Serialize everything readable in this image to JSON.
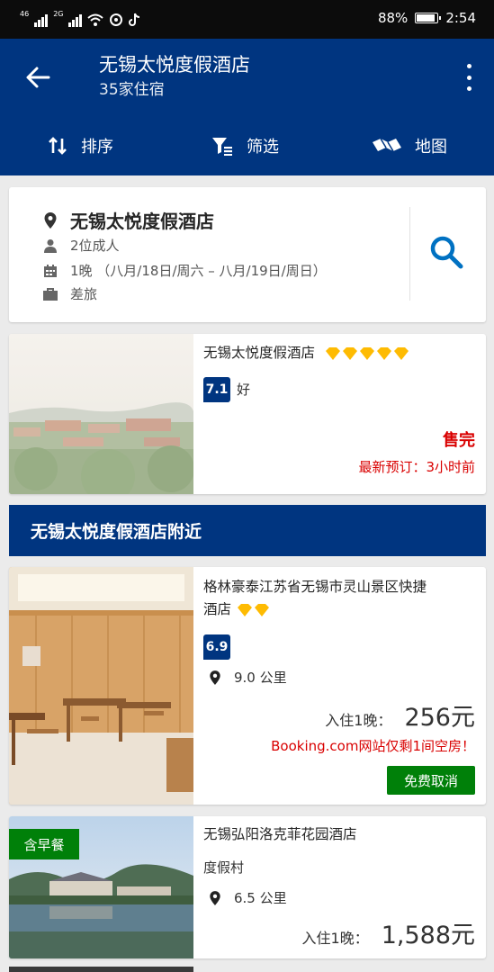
{
  "status_bar": {
    "network_1": "46",
    "network_2": "2G",
    "battery_percent": "88%",
    "time": "2:54"
  },
  "app_bar": {
    "title": "无锡太悦度假酒店",
    "subtitle": "35家住宿"
  },
  "toolbar": {
    "sort_label": "排序",
    "filter_label": "筛选",
    "map_label": "地图"
  },
  "search_summary": {
    "destination": "无锡太悦度假酒店",
    "guests": "2位成人",
    "dates": "1晚 （八月/18日/周六 – 八月/19日/周日）",
    "trip_type": "差旅"
  },
  "featured_hotel": {
    "name": "无锡太悦度假酒店",
    "star_count": 5,
    "score": "7.1",
    "score_word": "好",
    "status": "售完",
    "last_booked": "最新预订：3小时前"
  },
  "nearby_section": {
    "title": "无锡太悦度假酒店附近"
  },
  "nearby_hotels": [
    {
      "name_line1": "格林豪泰江苏省无锡市灵山景区快捷",
      "name_line2": "酒店",
      "star_count": 2,
      "score": "6.9",
      "distance": "9.0 公里",
      "price_label": "入住1晚：",
      "price": "256元",
      "availability_note": "Booking.com网站仅剩1间空房！",
      "free_cancel": "免费取消"
    },
    {
      "breakfast_badge": "含早餐",
      "name": "无锡弘阳洛克菲花园酒店",
      "category": "度假村",
      "distance": "6.5 公里",
      "price_label": "入住1晚：",
      "price": "1,588元"
    }
  ],
  "colors": {
    "brand_blue": "#003580",
    "star_gold": "#febb02",
    "alert_red": "#d90000",
    "green": "#008009"
  }
}
